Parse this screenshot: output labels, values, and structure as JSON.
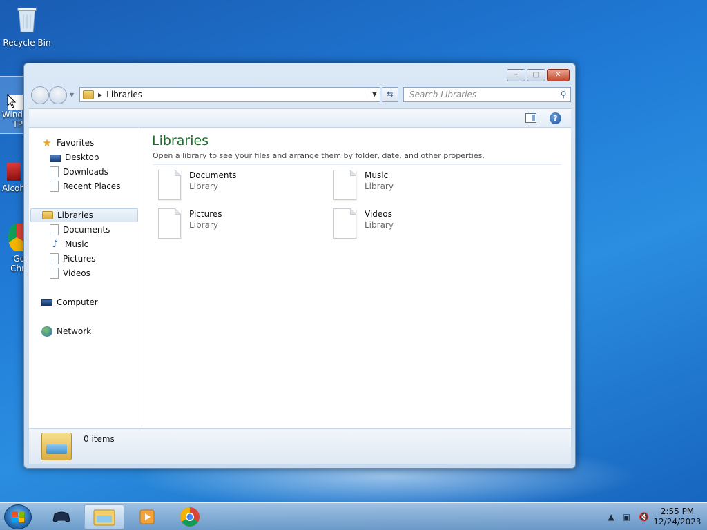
{
  "desktop": {
    "icons": [
      {
        "label": "Recycle Bin"
      },
      {
        "label": "Wind\nTP"
      },
      {
        "label": "Alcoh"
      },
      {
        "label": "Go\nChr"
      }
    ]
  },
  "window": {
    "caption": {
      "minimize": "–",
      "maximize": "□",
      "close": "✕"
    },
    "address": {
      "path": "Libraries"
    },
    "search": {
      "placeholder": "Search Libraries"
    },
    "toolbar": {
      "help": "?"
    },
    "nav": {
      "favorites": "Favorites",
      "desktop": "Desktop",
      "downloads": "Downloads",
      "recent_places": "Recent Places",
      "libraries": "Libraries",
      "documents": "Documents",
      "music": "Music",
      "pictures": "Pictures",
      "videos": "Videos",
      "computer": "Computer",
      "network": "Network"
    },
    "content": {
      "title": "Libraries",
      "subtitle": "Open a library to see your files and arrange them by folder, date, and other properties.",
      "libraries": [
        {
          "name": "Documents",
          "type": "Library"
        },
        {
          "name": "Music",
          "type": "Library"
        },
        {
          "name": "Pictures",
          "type": "Library"
        },
        {
          "name": "Videos",
          "type": "Library"
        }
      ]
    },
    "status": {
      "items": "0 items"
    }
  },
  "taskbar": {
    "tray": {
      "time": "2:55 PM",
      "date": "12/24/2023"
    }
  },
  "colors": {
    "title_green": "#1e6b2c",
    "desktop_blue": "#1f7ad6",
    "close_red": "#c44a2c"
  }
}
